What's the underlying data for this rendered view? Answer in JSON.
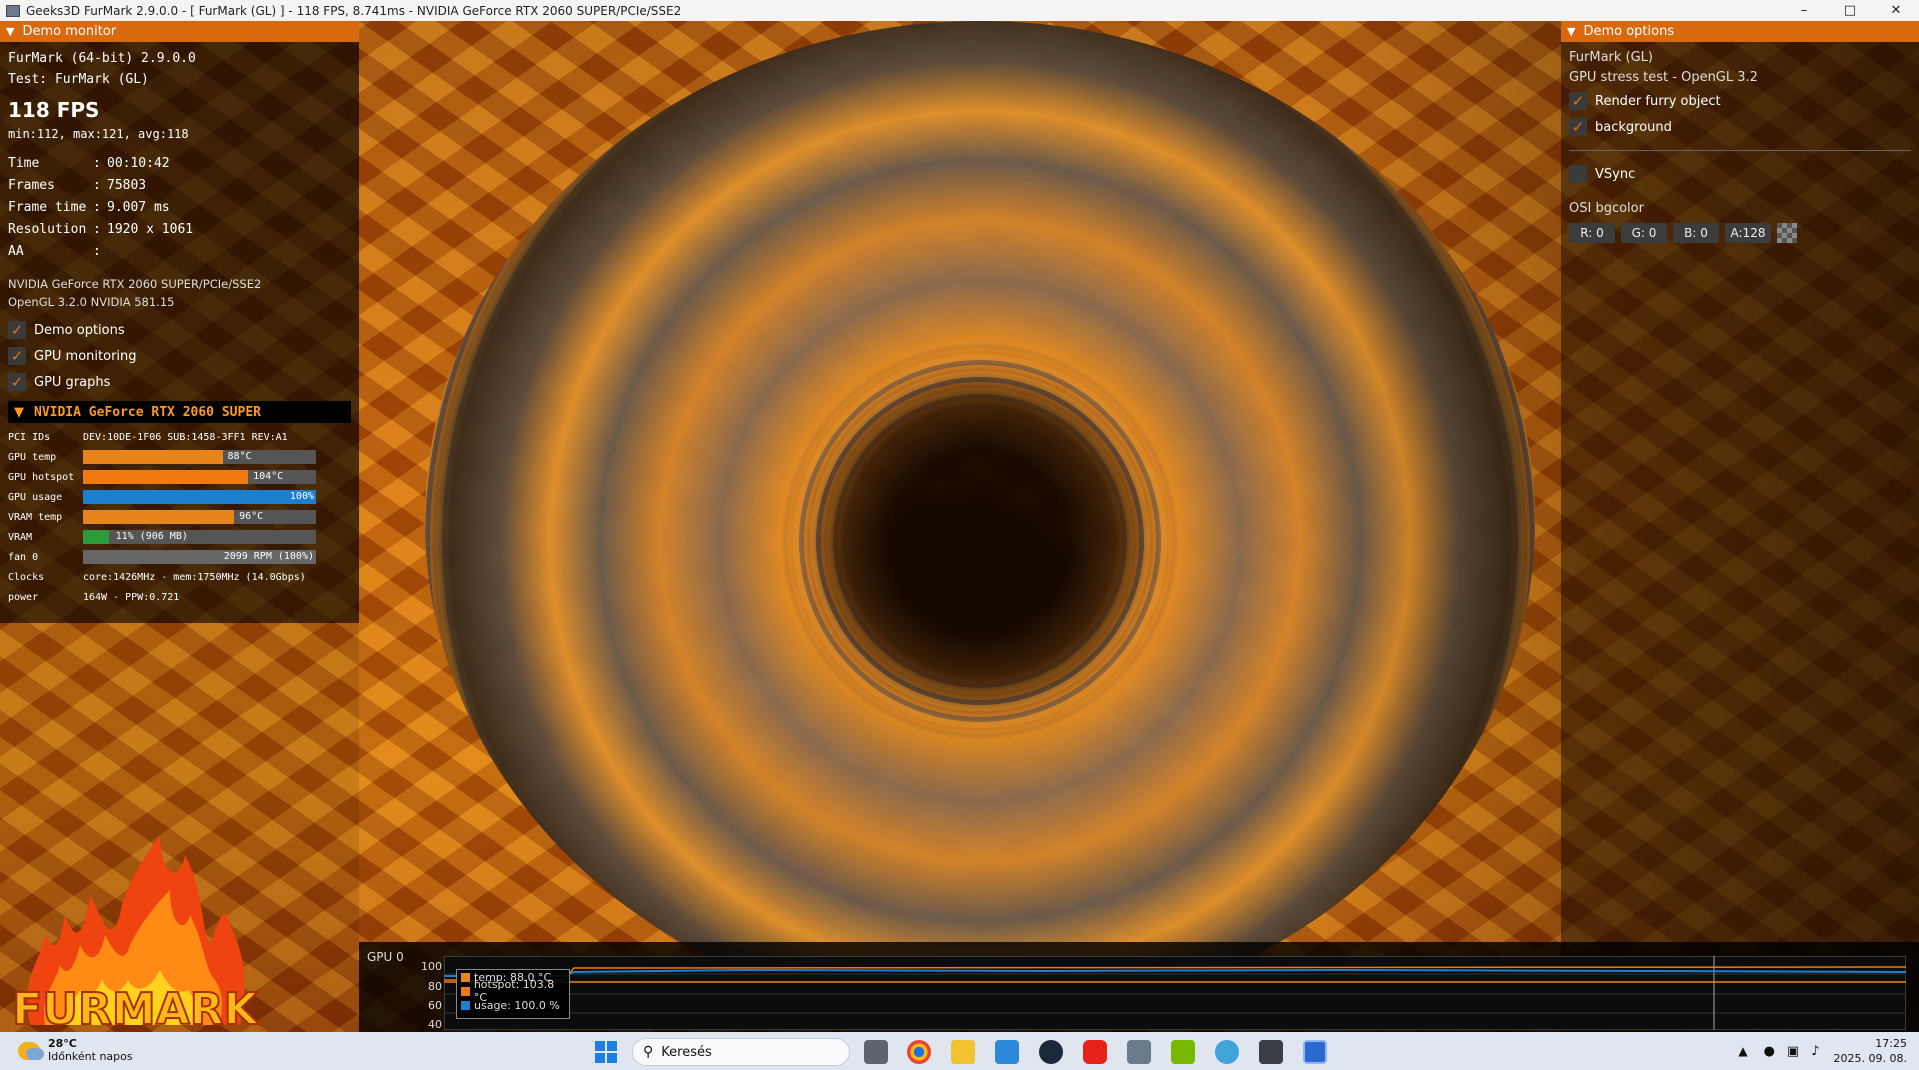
{
  "titlebar": {
    "title": "Geeks3D FurMark 2.9.0.0 - [ FurMark (GL) ] - 118 FPS, 8.741ms - NVIDIA GeForce RTX 2060 SUPER/PCIe/SSE2",
    "minimize_icon": "minimize-icon",
    "maximize_icon": "maximize-icon",
    "close_icon": "close-icon"
  },
  "monitor": {
    "header": "Demo monitor",
    "app": "FurMark (64-bit) 2.9.0.0",
    "test": "Test: FurMark (GL)",
    "fps": "118 FPS",
    "fps_stats": "min:112, max:121, avg:118",
    "stats": [
      {
        "key": "Time",
        "sep": ":",
        "value": "00:10:42"
      },
      {
        "key": "Frames",
        "sep": ":",
        "value": "75803"
      },
      {
        "key": "Frame time",
        "sep": ":",
        "value": "9.007 ms"
      },
      {
        "key": "Resolution",
        "sep": ":",
        "value": "1920 x 1061"
      },
      {
        "key": "AA",
        "sep": ":",
        "value": ""
      }
    ],
    "renderer": "NVIDIA GeForce RTX 2060 SUPER/PCIe/SSE2",
    "opengl": "OpenGL 3.2.0 NVIDIA 581.15",
    "checks": [
      {
        "label": "Demo options",
        "checked": true
      },
      {
        "label": "GPU monitoring",
        "checked": true
      },
      {
        "label": "GPU graphs",
        "checked": true
      }
    ],
    "gpu": {
      "name": "NVIDIA GeForce RTX 2060 SUPER",
      "pci_label": "PCI IDs",
      "pci_value": "DEV:10DE-1F06 SUB:1458-3FF1 REV:A1",
      "bars": [
        {
          "label": "GPU temp",
          "text": "88°C",
          "fraction": 0.6,
          "color": "#e8841a"
        },
        {
          "label": "GPU hotspot",
          "text": "104°C",
          "fraction": 0.71,
          "color": "#f07a10"
        },
        {
          "label": "GPU usage",
          "text": "100%",
          "fraction": 1.0,
          "color": "#1c7fd0"
        },
        {
          "label": "VRAM temp",
          "text": "96°C",
          "fraction": 0.65,
          "color": "#e8841a"
        },
        {
          "label": "VRAM",
          "text": "11% (906 MB)",
          "fraction": 0.11,
          "color": "#2a9a3a"
        },
        {
          "label": "fan 0",
          "text": "2099 RPM (100%)",
          "fraction": 1.0,
          "color": "#666666"
        }
      ],
      "clocks_label": "Clocks",
      "clocks_value": "core:1426MHz - mem:1750MHz (14.0Gbps)",
      "power_label": "power",
      "power_value": "164W - PPW:0.721"
    }
  },
  "logo_text": "FURMARK",
  "options": {
    "header": "Demo options",
    "line1": "FurMark (GL)",
    "line2": "GPU stress test - OpenGL 3.2",
    "checks": [
      {
        "label": "Render furry object",
        "checked": true
      },
      {
        "label": "background",
        "checked": true
      }
    ],
    "vsync": {
      "label": "VSync",
      "checked": false
    },
    "osi_label": "OSI bgcolor",
    "color_fields": [
      "R: 0",
      "G: 0",
      "B: 0",
      "A:128"
    ]
  },
  "graph": {
    "title": "GPU 0",
    "yticks": [
      "100",
      "80",
      "60",
      "40"
    ],
    "legend": [
      {
        "text": "temp: 88.0 °C",
        "color": "#e8841a"
      },
      {
        "text": "hotspot: 103.8 °C",
        "color": "#f07a10"
      },
      {
        "text": "usage: 100.0 %",
        "color": "#1c7fd0"
      }
    ]
  },
  "taskbar": {
    "temp": "28°C",
    "weather": "Időnként napos",
    "search": "Keresés",
    "time": "17:25",
    "date": "2025. 09. 08."
  }
}
